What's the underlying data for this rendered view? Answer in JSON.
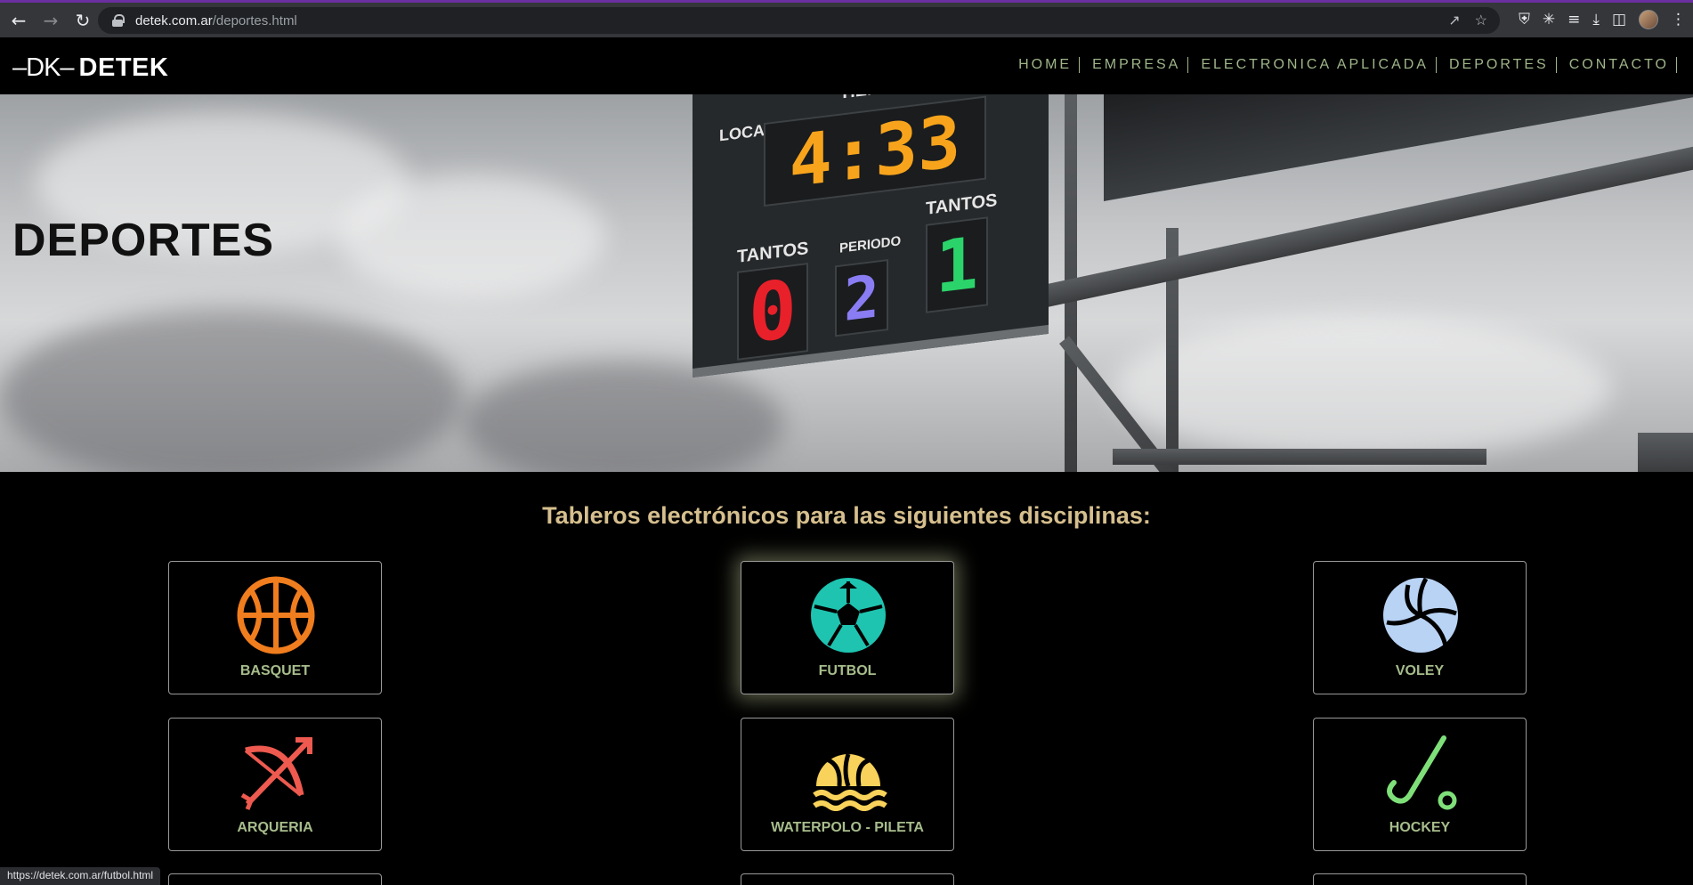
{
  "browser": {
    "url_host": "detek.com.ar",
    "url_path": "/deportes.html",
    "status_url": "https://detek.com.ar/futbol.html"
  },
  "site": {
    "logo_mark": "–DK–",
    "logo_text": "DETEK",
    "nav": [
      "HOME",
      "EMPRESA",
      "ELECTRONICA APLICADA",
      "DEPORTES",
      "CONTACTO"
    ]
  },
  "hero": {
    "title": "DEPORTES",
    "scoreboard": {
      "tiempo_label": "TIEMPO",
      "local_label": "LOCAL",
      "time": "4:33",
      "tantos_left_label": "TANTOS",
      "periodo_label": "PERIODO",
      "tantos_right_label": "TANTOS",
      "score_left": "0",
      "periodo": "2",
      "score_right": "1"
    }
  },
  "main": {
    "section_title": "Tableros electrónicos para las siguientes disciplinas:",
    "sports": [
      {
        "label": "BASQUET",
        "icon": "basketball-icon",
        "color": "#f07d1e"
      },
      {
        "label": "FUTBOL",
        "icon": "soccer-ball-icon",
        "color": "#1ec4b0"
      },
      {
        "label": "VOLEY",
        "icon": "volleyball-icon",
        "color": "#b9d3f5"
      },
      {
        "label": "ARQUERIA",
        "icon": "bow-arrow-icon",
        "color": "#ee5a4f"
      },
      {
        "label": "WATERPOLO - PILETA",
        "icon": "waterpolo-icon",
        "color": "#f8d25a"
      },
      {
        "label": "HOCKEY",
        "icon": "hockey-stick-icon",
        "color": "#7fe07a"
      }
    ]
  },
  "colors": {
    "nav_text": "#9fb58a",
    "section_title": "#d6bf8e",
    "card_label": "#a7bd8c",
    "led_red": "#e8202a",
    "led_orange": "#f7a41c",
    "led_blue": "#8a7cf2",
    "led_green": "#2bd46a"
  }
}
